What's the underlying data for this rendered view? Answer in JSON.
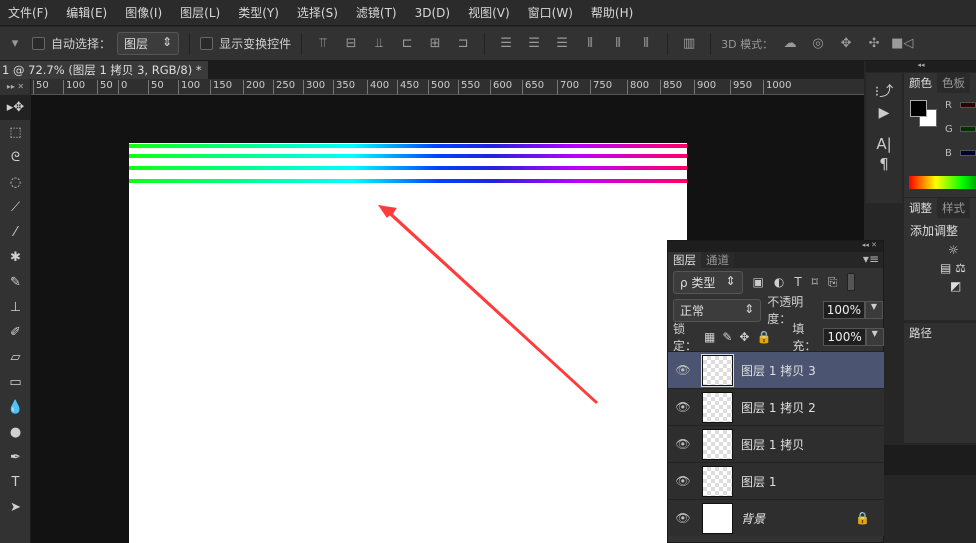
{
  "menu": [
    "文件(F)",
    "编辑(E)",
    "图像(I)",
    "图层(L)",
    "类型(Y)",
    "选择(S)",
    "滤镜(T)",
    "3D(D)",
    "视图(V)",
    "窗口(W)",
    "帮助(H)"
  ],
  "options": {
    "auto_select": "自动选择：",
    "auto_select_value": "图层",
    "show_transform": "显示变换控件",
    "mode_3d": "3D 模式："
  },
  "document_tab": {
    "title": "1 @ 72.7% (图层 1  拷贝 3, RGB/8) *",
    "close": "×"
  },
  "ruler": [
    "50",
    "100",
    "50",
    "0",
    "50",
    "100",
    "150",
    "200",
    "250",
    "300",
    "350",
    "400",
    "450",
    "500",
    "550",
    "600",
    "650",
    "700",
    "750",
    "800",
    "850",
    "900",
    "950",
    "1000"
  ],
  "color_panel": {
    "tabs": [
      "颜色",
      "色板"
    ],
    "channels": [
      "R",
      "G",
      "B"
    ]
  },
  "adjust_panel": {
    "tabs": [
      "调整",
      "样式"
    ],
    "title": "添加调整"
  },
  "paths_panel": {
    "tab": "路径"
  },
  "layers_panel": {
    "tabs": [
      "图层",
      "通道"
    ],
    "filter": "ρ 类型",
    "blend_mode": "正常",
    "opacity_label": "不透明度：",
    "opacity": "100%",
    "lock_label": "锁定：",
    "fill_label": "填充：",
    "fill": "100%",
    "layers": [
      {
        "name": "图层 1  拷贝 3"
      },
      {
        "name": "图层 1  拷贝 2"
      },
      {
        "name": "图层 1  拷贝"
      },
      {
        "name": "图层 1"
      },
      {
        "name": "背景"
      }
    ]
  },
  "colors": {
    "accent_selection": "#4b5470",
    "arrow": "#ff3b3b"
  }
}
